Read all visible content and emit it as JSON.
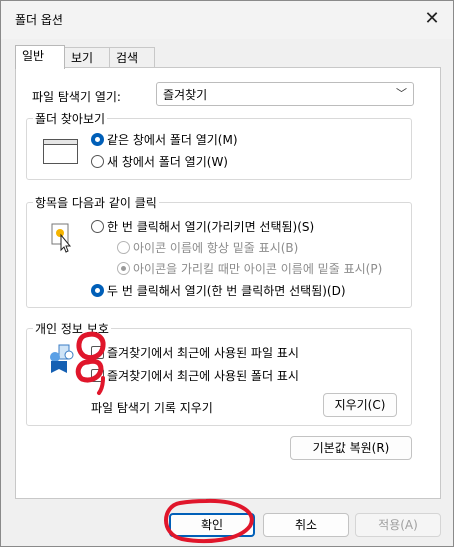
{
  "window": {
    "title": "폴더 옵션",
    "close_icon": "close-icon"
  },
  "tabs": [
    {
      "label": "일반"
    },
    {
      "label": "보기"
    },
    {
      "label": "검색"
    }
  ],
  "general": {
    "open_explorer_label": "파일 탐색기 열기:",
    "open_explorer_value": "즐겨찾기",
    "browse_folders": {
      "title": "폴더 찾아보기",
      "options": [
        {
          "label": "같은 창에서 폴더 열기(M)",
          "selected": true
        },
        {
          "label": "새 창에서 폴더 열기(W)",
          "selected": false
        }
      ]
    },
    "click_items": {
      "title": "항목을 다음과 같이 클릭",
      "single_click": "한 번 클릭해서 열기(가리키면 선택됨)(S)",
      "underline_always": "아이콘 이름에 항상 밑줄 표시(B)",
      "underline_hover": "아이콘을 가리킬 때만 아이콘 이름에 밑줄 표시(P)",
      "double_click": "두 번 클릭해서 열기(한 번 클릭하면 선택됨)(D)"
    },
    "privacy": {
      "title": "개인 정보 보호",
      "recent_files": "즐겨찾기에서 최근에 사용된 파일 표시",
      "recent_folders": "즐겨찾기에서 최근에 사용된 폴더 표시",
      "clear_history_label": "파일 탐색기 기록 지우기",
      "clear_button": "지우기(C)"
    },
    "restore_defaults": "기본값 복원(R)"
  },
  "footer": {
    "ok": "확인",
    "cancel": "취소",
    "apply": "적용(A)"
  },
  "colors": {
    "accent": "#005fb8",
    "annotation": "#e0162b"
  }
}
